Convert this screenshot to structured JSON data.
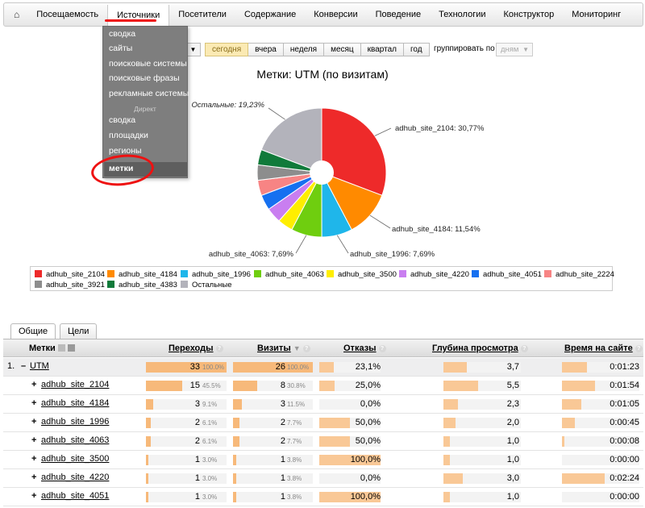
{
  "nav": {
    "home_icon": "⌂",
    "items": [
      "Посещаемость",
      "Источники",
      "Посетители",
      "Содержание",
      "Конверсии",
      "Поведение",
      "Технологии",
      "Конструктор",
      "Мониторинг"
    ]
  },
  "dropdown": {
    "items": [
      "сводка",
      "сайты",
      "поисковые системы",
      "поисковые фразы",
      "рекламные системы"
    ],
    "section": "Директ",
    "direct_items": [
      "сводка",
      "площадки",
      "регионы"
    ],
    "active": "метки"
  },
  "periods": [
    "сегодня",
    "вчера",
    "неделя",
    "месяц",
    "квартал",
    "год"
  ],
  "group_by": {
    "label": "группировать по",
    "value": "дням"
  },
  "chart_data": {
    "type": "pie",
    "title": "Метки: UTM (по визитам)",
    "slices": [
      {
        "name": "adhub_site_2104",
        "value": 30.77,
        "color": "#ee2a2a"
      },
      {
        "name": "adhub_site_4184",
        "value": 11.54,
        "color": "#ff8a00"
      },
      {
        "name": "adhub_site_1996",
        "value": 7.69,
        "color": "#1fb6ea"
      },
      {
        "name": "adhub_site_4063",
        "value": 7.69,
        "color": "#6fce0f"
      },
      {
        "name": "adhub_site_3500",
        "value": 3.85,
        "color": "#ffee00"
      },
      {
        "name": "adhub_site_4220",
        "value": 3.85,
        "color": "#c97ef0"
      },
      {
        "name": "adhub_site_4051",
        "value": 3.85,
        "color": "#1670f0"
      },
      {
        "name": "adhub_site_2224",
        "value": 3.85,
        "color": "#f78484"
      },
      {
        "name": "adhub_site_3921",
        "value": 3.85,
        "color": "#8d8d8d"
      },
      {
        "name": "adhub_site_4383",
        "value": 3.85,
        "color": "#107a3a"
      },
      {
        "name": "Остальные",
        "value": 19.23,
        "color": "#b3b3bb"
      }
    ],
    "labels": {
      "adhub_site_2104": "adhub_site_2104: 30,77%",
      "adhub_site_4184": "adhub_site_4184: 11,54%",
      "adhub_site_1996": "adhub_site_1996: 7,69%",
      "adhub_site_4063": "adhub_site_4063: 7,69%",
      "Остальные": "Остальные: 19,23%"
    },
    "legend": [
      "adhub_site_2104",
      "adhub_site_4184",
      "adhub_site_1996",
      "adhub_site_4063",
      "adhub_site_3500",
      "adhub_site_4220",
      "adhub_site_4051",
      "adhub_site_2224",
      "adhub_site_3921",
      "adhub_site_4383",
      "Остальные"
    ]
  },
  "tabs": [
    "Общие",
    "Цели"
  ],
  "table": {
    "headers": {
      "tags": "Метки",
      "transitions": "Переходы",
      "visits": "Визиты",
      "bounces": "Отказы",
      "depth": "Глубина просмотра",
      "time": "Время на сайте"
    },
    "total": {
      "index": "1.",
      "toggle": "–",
      "name": "UTM",
      "transitions": 33,
      "transitions_pct": "100.0%",
      "visits": 26,
      "visits_pct": "100.0%",
      "bounces": "23,1%",
      "bounces_frac": 0.231,
      "depth": "3,7",
      "depth_frac": 0.3,
      "time": "0:01:23",
      "time_frac": 0.32
    },
    "rows": [
      {
        "toggle": "+",
        "name": "adhub_site_2104",
        "transitions": 15,
        "transitions_pct": "45.5%",
        "visits": 8,
        "visits_pct": "30.8%",
        "bounces": "25,0%",
        "bounces_frac": 0.25,
        "depth": "5,5",
        "depth_frac": 0.45,
        "time": "0:01:54",
        "time_frac": 0.43
      },
      {
        "toggle": "+",
        "name": "adhub_site_4184",
        "transitions": 3,
        "transitions_pct": "9.1%",
        "visits": 3,
        "visits_pct": "11.5%",
        "bounces": "0,0%",
        "bounces_frac": 0,
        "depth": "2,3",
        "depth_frac": 0.19,
        "time": "0:01:05",
        "time_frac": 0.25
      },
      {
        "toggle": "+",
        "name": "adhub_site_1996",
        "transitions": 2,
        "transitions_pct": "6.1%",
        "visits": 2,
        "visits_pct": "7.7%",
        "bounces": "50,0%",
        "bounces_frac": 0.5,
        "depth": "2,0",
        "depth_frac": 0.16,
        "time": "0:00:45",
        "time_frac": 0.17
      },
      {
        "toggle": "+",
        "name": "adhub_site_4063",
        "transitions": 2,
        "transitions_pct": "6.1%",
        "visits": 2,
        "visits_pct": "7.7%",
        "bounces": "50,0%",
        "bounces_frac": 0.5,
        "depth": "1,0",
        "depth_frac": 0.08,
        "time": "0:00:08",
        "time_frac": 0.03
      },
      {
        "toggle": "+",
        "name": "adhub_site_3500",
        "transitions": 1,
        "transitions_pct": "3.0%",
        "visits": 1,
        "visits_pct": "3.8%",
        "bounces": "100,0%",
        "bounces_frac": 1.0,
        "depth": "1,0",
        "depth_frac": 0.08,
        "time": "0:00:00",
        "time_frac": 0
      },
      {
        "toggle": "+",
        "name": "adhub_site_4220",
        "transitions": 1,
        "transitions_pct": "3.0%",
        "visits": 1,
        "visits_pct": "3.8%",
        "bounces": "0,0%",
        "bounces_frac": 0,
        "depth": "3,0",
        "depth_frac": 0.25,
        "time": "0:02:24",
        "time_frac": 0.55
      },
      {
        "toggle": "+",
        "name": "adhub_site_4051",
        "transitions": 1,
        "transitions_pct": "3.0%",
        "visits": 1,
        "visits_pct": "3.8%",
        "bounces": "100,0%",
        "bounces_frac": 1.0,
        "depth": "1,0",
        "depth_frac": 0.08,
        "time": "0:00:00",
        "time_frac": 0
      }
    ]
  }
}
